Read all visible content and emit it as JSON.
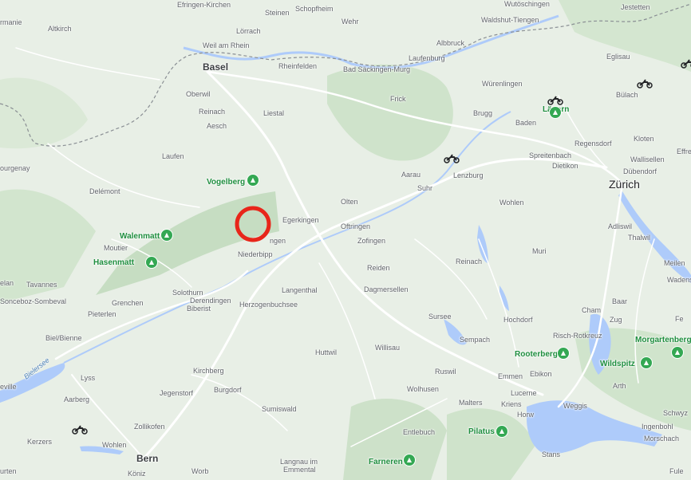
{
  "map": {
    "labels": {
      "emmendingen_top": "Efringen-Kirchen",
      "steinen": "Steinen",
      "schopfheim": "Schopfheim",
      "wutoschingen": "Wutöschingen",
      "jestetten": "Jestetten",
      "altkirch": "Altkirch",
      "germanie": "rmanie",
      "weil": "Weil am Rhein",
      "lorrach": "Lörrach",
      "wehr": "Wehr",
      "waldshut": "Waldshut-Tiengen",
      "albbruck": "Albbruck",
      "eglisau": "Eglisau",
      "basel": "Basel",
      "rheinfelden": "Rheinfelden",
      "bad_sackingen": "Bad Säckingen-Murg",
      "laufenburg": "Laufenburg",
      "wurenlingen": "Würenlingen",
      "oberwil": "Oberwil",
      "reinach": "Reinach",
      "aesch": "Aesch",
      "liestal": "Liestal",
      "frick": "Frick",
      "brugg": "Brugg",
      "baden": "Baden",
      "bulach": "Bülach",
      "lagern": "Lägern",
      "kloten": "Kloten",
      "effre": "Effre",
      "regensdorf": "Regensdorf",
      "laufen": "Laufen",
      "spreitenbach": "Spreitenbach",
      "dietikon": "Dietikon",
      "wallisellen": "Wallisellen",
      "dubendorf": "Dübendorf",
      "gorgenay": "ourgenay",
      "vogelberg": "Vogelberg",
      "aarau": "Aarau",
      "lenzburg": "Lenzburg",
      "suhr": "Suhr",
      "zurich": "Zürich",
      "delemont": "Delémont",
      "olten": "Olten",
      "egerkingen": "Egerkingen",
      "wohlen": "Wohlen",
      "adliswil": "Adliswil",
      "thalwil": "Thalwil",
      "walenmatt": "Walenmatt",
      "oftringen": "Oftringen",
      "oensingen": "ngen",
      "zofingen": "Zofingen",
      "moutier": "Moutier",
      "hasenmatt": "Hasenmatt",
      "niederbipp": "Niederbipp",
      "muri": "Muri",
      "meilen": "Meilen",
      "reinach_ag": "Reinach",
      "reiden": "Reiden",
      "wadens": "Wadens",
      "elan": "elan",
      "tavannes": "Tavannes",
      "langenthal": "Langenthal",
      "dagmersellen": "Dagmersellen",
      "solothurn": "Solothurn",
      "sonceboz": "Sonceboz-Sombeval",
      "grenchen": "Grenchen",
      "derendingen": "Derendingen",
      "herzogenbuchsee": "Herzogenbuchsee",
      "cham": "Cham",
      "baar": "Baar",
      "biberist": "Biberist",
      "pieterlen": "Pieterlen",
      "sursee": "Sursee",
      "hochdorf": "Hochdorf",
      "zug": "Zug",
      "fe": "Fe",
      "risch": "Risch-Rotkreuz",
      "biel": "Biel/Bienne",
      "sempach": "Sempach",
      "morgartenberg": "Morgartenberg",
      "willisau": "Willisau",
      "huttwil": "Huttwil",
      "rooterberg": "Rooterberg",
      "lyss": "Lyss",
      "bielersee": "Bielersee",
      "eville": "eville",
      "wildspitz": "Wildspitz",
      "kirchberg": "Kirchberg",
      "ruswil": "Ruswil",
      "emmen": "Emmen",
      "ebikon": "Ebikon",
      "arth": "Arth",
      "jegenstorf": "Jegenstorf",
      "burgdorf": "Burgdorf",
      "wolhusen": "Wolhusen",
      "lucerne": "Lucerne",
      "aarberg": "Aarberg",
      "malters": "Malters",
      "kriens": "Kriens",
      "weggis": "Weggis",
      "schwyz": "Schwyz",
      "sumiswald": "Sumiswald",
      "horw": "Horw",
      "zollikofen": "Zollikofen",
      "ingenbohl": "Ingenbohl",
      "entlebuch": "Entlebuch",
      "pilatus": "Pilatus",
      "morschach": "Morschach",
      "kerzers": "Kerzers",
      "wohlen_be": "Wohlen",
      "bern": "Bern",
      "langnau": "Langnau im",
      "emmental": "Emmental",
      "farneren": "Farneren",
      "stans": "Stans",
      "urten": "urten",
      "worb": "Worb",
      "koniz": "Köniz",
      "fule": "Fule"
    },
    "icons": {
      "poi": "mountain-peak-icon",
      "traffic": "motorcycle-icon",
      "marker": "selection-circle-icon"
    },
    "colors": {
      "base": "#e8efe6",
      "forest": "#c8dfc4",
      "road": "#ffffff",
      "water": "#aecbfa",
      "border": "#8a8f94",
      "marker": "#e8261a",
      "poi": "#34a853"
    }
  }
}
